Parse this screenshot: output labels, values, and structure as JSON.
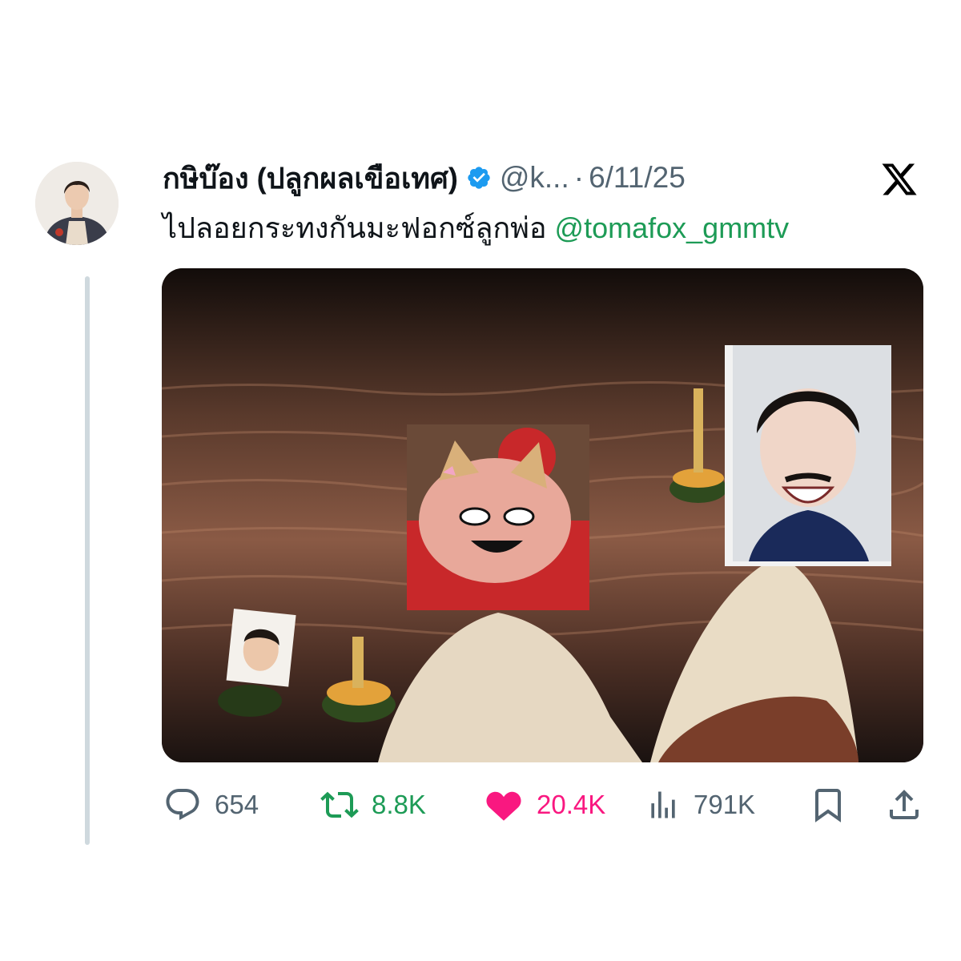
{
  "post": {
    "display_name": "กษิบ๊อง (ปลูกผลเขือเทศ)",
    "handle": "@k...",
    "separator": "·",
    "date": "6/11/25",
    "text": "ไปลอยกระทงกันมะฟอกซ์ลูกพ่อ",
    "mention": "@tomafox_gmmtv"
  },
  "metrics": {
    "replies": "654",
    "reposts": "8.8K",
    "likes": "20.4K",
    "views": "791K"
  },
  "icons": {
    "verified": "verified-badge-icon",
    "platform": "x-logo-icon",
    "reply": "reply-icon",
    "repost": "repost-icon",
    "like": "heart-icon",
    "views": "views-icon",
    "bookmark": "bookmark-icon",
    "share": "share-icon"
  },
  "colors": {
    "verified": "#1d9bf0",
    "mention": "#1d9b56",
    "repost": "#1d9b56",
    "like": "#f91880",
    "muted": "#536471"
  }
}
